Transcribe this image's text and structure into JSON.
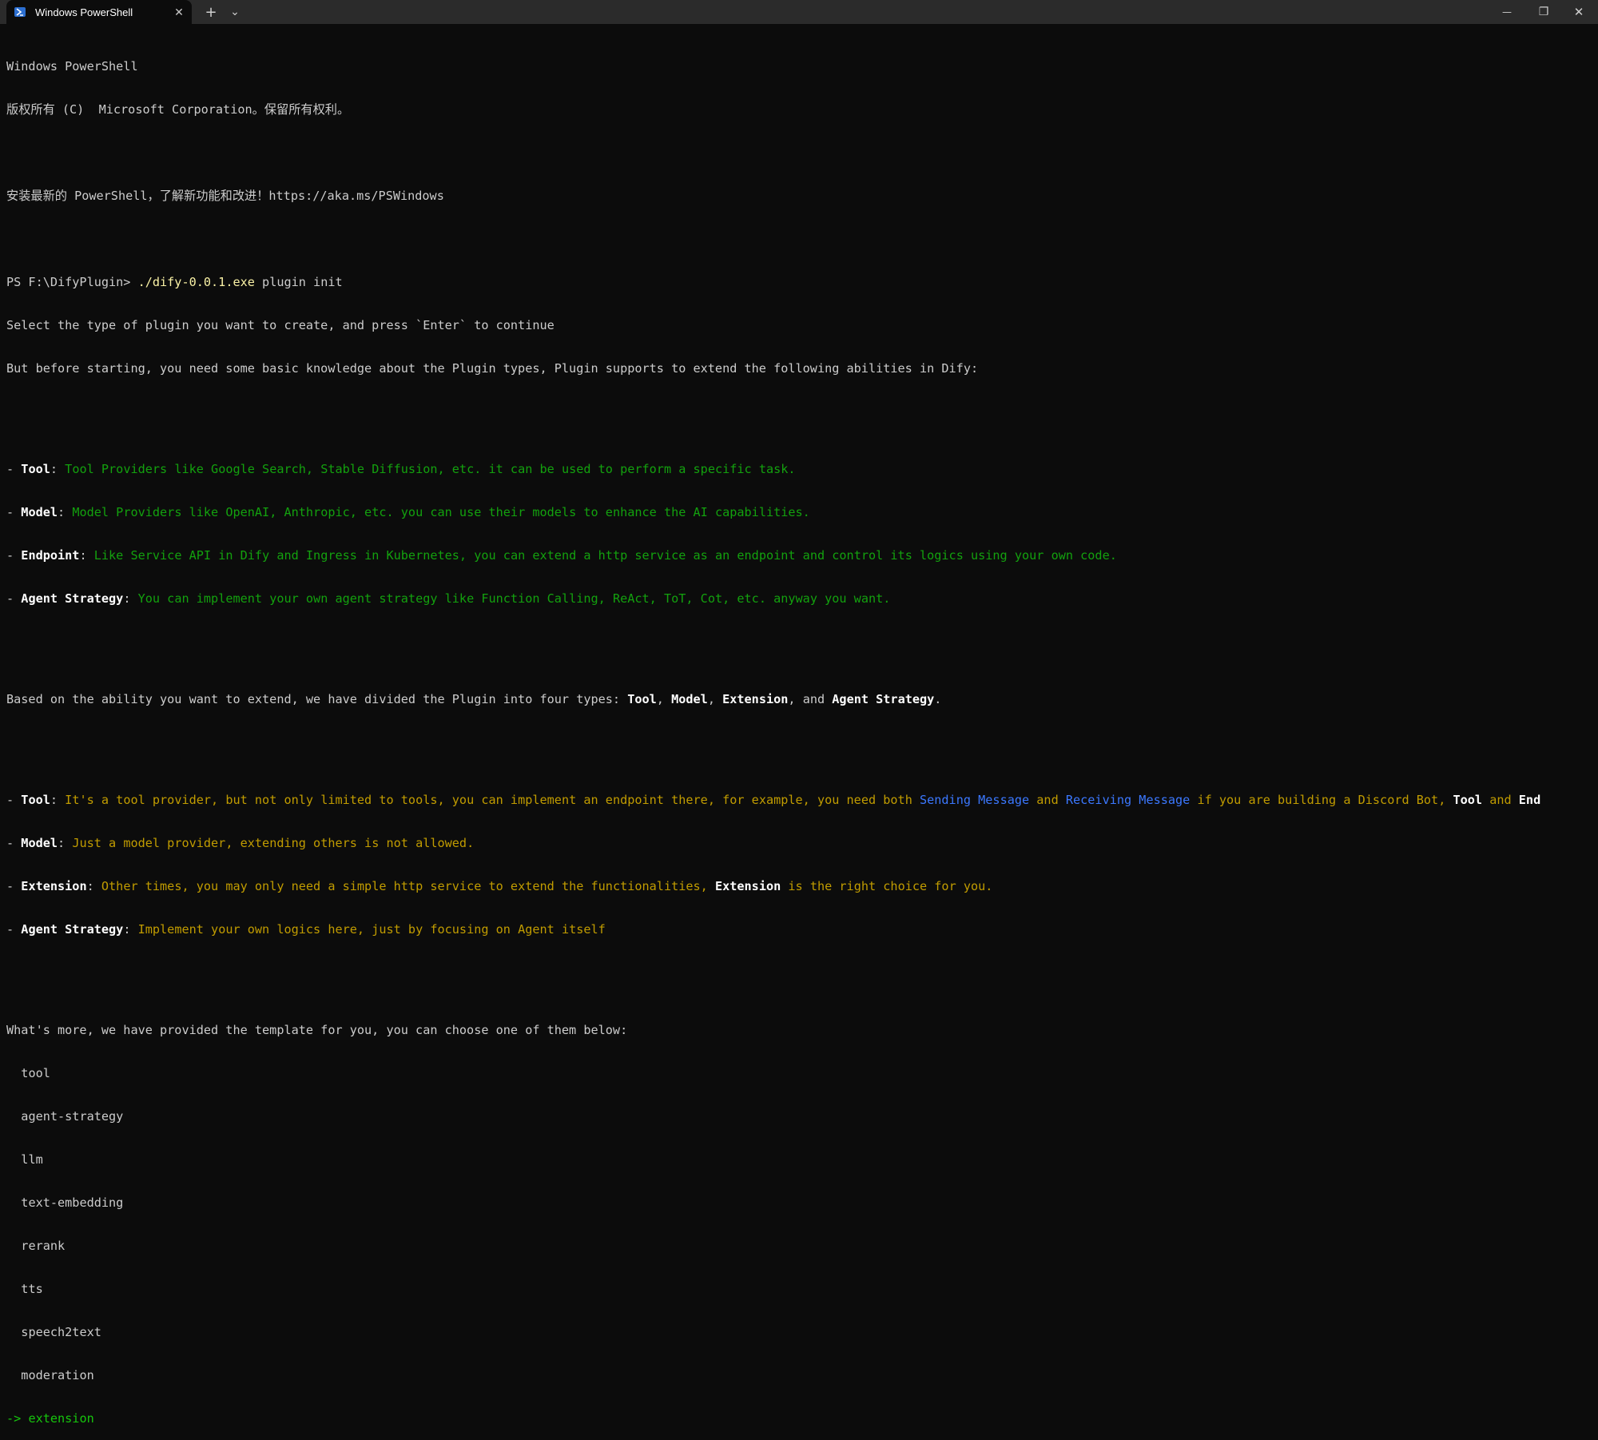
{
  "window": {
    "tab_title": "Windows PowerShell",
    "tab_close": "✕",
    "new_tab": "+",
    "tab_menu": "⌄",
    "minimize": "—",
    "maximize": "❐",
    "close": "✕"
  },
  "terminal": {
    "banner1": "Windows PowerShell",
    "banner2": "版权所有 (C)  Microsoft Corporation。保留所有权利。",
    "banner3": "安装最新的 PowerShell，了解新功能和改进！https://aka.ms/PSWindows",
    "prompt": "PS F:\\DifyPlugin> ",
    "command_exe": "./dify-0.0.1.exe",
    "command_args": " plugin init",
    "select_line": "Select the type of plugin you want to create, and press `Enter` to continue",
    "before_line": "But before starting, you need some basic knowledge about the Plugin types, Plugin supports to extend the following abilities in Dify:",
    "abilities": [
      {
        "name": "Tool",
        "desc": "Tool Providers like Google Search, Stable Diffusion, etc. it can be used to perform a specific task."
      },
      {
        "name": "Model",
        "desc": "Model Providers like OpenAI, Anthropic, etc. you can use their models to enhance the AI capabilities."
      },
      {
        "name": "Endpoint",
        "desc": "Like Service API in Dify and Ingress in Kubernetes, you can extend a http service as an endpoint and control its logics using your own code."
      },
      {
        "name": "Agent Strategy",
        "desc": "You can implement your own agent strategy like Function Calling, ReAct, ToT, Cot, etc. anyway you want."
      }
    ],
    "based_prefix": "Based on the ability you want to extend, we have divided the Plugin into four types: ",
    "based_tool": "Tool",
    "based_model": "Model",
    "based_extension": "Extension",
    "based_and": ", and ",
    "based_agent": "Agent Strategy",
    "based_end": ".",
    "types": {
      "tool_name": "Tool",
      "tool_desc1": "It's a tool provider, but not only limited to tools, you can implement an endpoint there, for example, you need both ",
      "tool_send": "Sending Message",
      "tool_and": " and ",
      "tool_recv": "Receiving Message",
      "tool_desc2": " if you are building a Discord Bot, ",
      "tool_bold1": "Tool",
      "tool_and2": " and ",
      "tool_bold2": "End",
      "model_name": "Model",
      "model_desc": "Just a model provider, extending others is not allowed.",
      "ext_name": "Extension",
      "ext_desc1": "Other times, you may only need a simple http service to extend the functionalities, ",
      "ext_bold": "Extension",
      "ext_desc2": " is the right choice for you.",
      "agent_name": "Agent Strategy",
      "agent_desc": "Implement your own logics here, just by focusing on Agent itself"
    },
    "template_line": "What's more, we have provided the template for you, you can choose one of them below:",
    "templates": [
      "tool",
      "agent-strategy",
      "llm",
      "text-embedding",
      "rerank",
      "tts",
      "speech2text",
      "moderation"
    ],
    "selected_arrow": "-> ",
    "selected_template": "extension"
  },
  "colors": {
    "background": "#0c0c0c",
    "titlebar": "#2b2b2b",
    "green": "#13a10e",
    "orange": "#c19c00",
    "blue": "#3b78ff",
    "yellow": "#f9f1a5"
  }
}
